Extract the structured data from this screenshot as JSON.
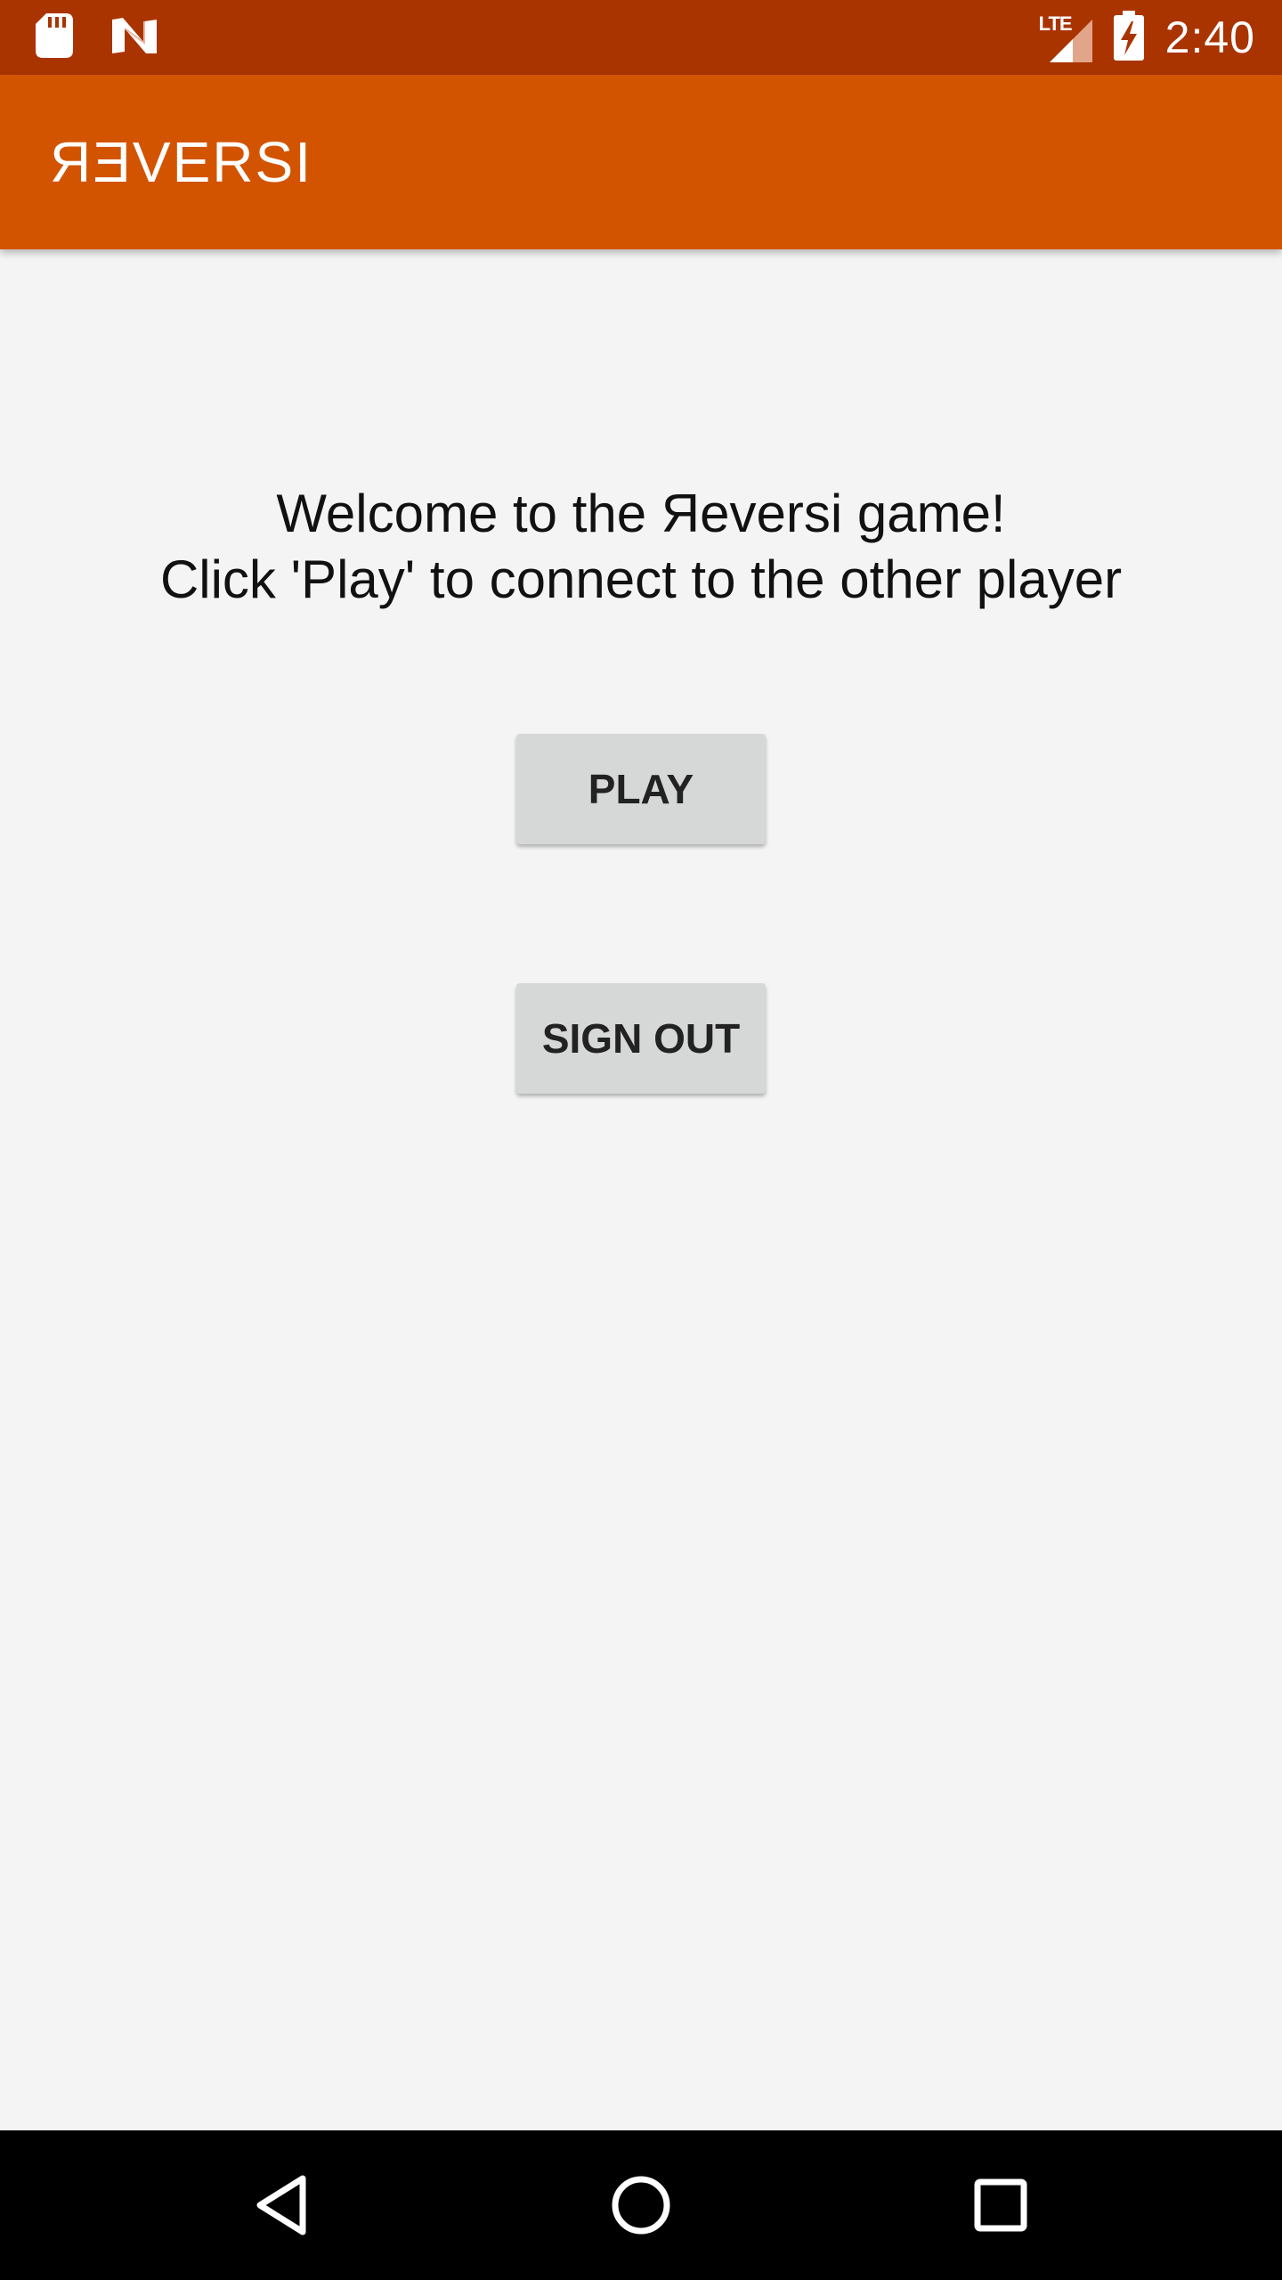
{
  "status_bar": {
    "left_icons": [
      "sd-card-icon",
      "n-notification-icon"
    ],
    "network_label": "LTE",
    "right_icons": [
      "lte-signal-icon",
      "battery-charging-icon"
    ],
    "time": "2:40",
    "colors": {
      "background": "#a93400",
      "foreground": "#ffffff"
    }
  },
  "app_bar": {
    "title": "ЯƎVERSI",
    "colors": {
      "background": "#d35400",
      "title": "#ffffff"
    }
  },
  "main": {
    "welcome_line1": "Welcome to the Яeversi game!",
    "welcome_line2": "Click 'Play' to connect to the other player",
    "play_label": "PLAY",
    "sign_out_label": "SIGN OUT",
    "colors": {
      "background": "#f4f4f4",
      "button": "#d6d7d7",
      "text": "#111111"
    }
  },
  "nav_bar": {
    "icons": [
      "back-triangle-icon",
      "home-circle-icon",
      "recents-square-icon"
    ],
    "colors": {
      "background": "#000000",
      "icon": "#ffffff"
    }
  }
}
